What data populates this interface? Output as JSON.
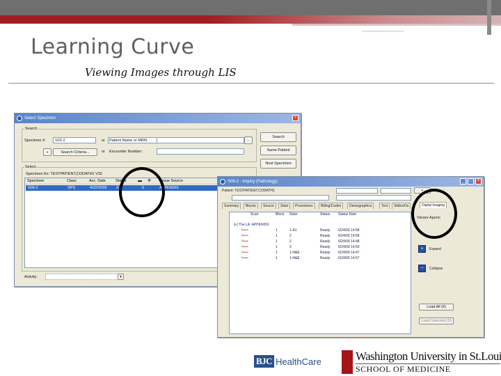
{
  "slide": {
    "title": "Learning Curve",
    "subtitle": "Viewing Images through LIS"
  },
  "select_window": {
    "title": "Select Specimen",
    "search_group_label": "Search",
    "specimen_label": "Specimen #:",
    "specimen_value": "S09-2",
    "or_label_1": "or",
    "patient_label": "Patient Name or MRN:",
    "or_label_2": "or",
    "search_criteria_button": "Search Criteria...",
    "encounter_label": "Encounter Number:",
    "search_button": "Search",
    "same_patient_button": "Same Patient",
    "next_specimen_button": "Next Specimen",
    "select_group_label": "Select",
    "specimen_for_label": "Specimen for: TESTPATIENT,CODATH1 V32",
    "columns": [
      "Specimen",
      "Class",
      "Acc. Date",
      "Status",
      "",
      "",
      "Tissue Source"
    ],
    "row": {
      "specimen": "S09-2",
      "class": "SPS",
      "date": "4/22/2009",
      "status": "S",
      "count": "6",
      "source": "APPENDIX"
    },
    "activity_label": "Activity:"
  },
  "inquiry_window": {
    "title": "S09-2 - Inquiry (Pathology)",
    "patient_label": "Patient: TESTPATIENT,CODATH1",
    "tabs": [
      "Summary",
      "Blocks",
      "Source",
      "Stain",
      "Procedures",
      "Billing/Codes",
      "Demographics",
      "Text",
      "Slides/Os",
      "Digital Imaging"
    ],
    "right_tab": "Digital Imaging",
    "viewer_label": "Viewer Aperio",
    "tree_headers": [
      "Scan",
      "Block",
      "Stain",
      "Status",
      "Status Date"
    ],
    "root_item": "[+] The LA: APPENDIX",
    "rows": [
      {
        "block": "1",
        "stain": "1-A1",
        "status": "Ready",
        "date": "6/24/09 14:58"
      },
      {
        "block": "1",
        "stain": "2",
        "status": "Ready",
        "date": "6/24/09 14:58"
      },
      {
        "block": "1",
        "stain": "2",
        "status": "Ready",
        "date": "6/24/09 14:48"
      },
      {
        "block": "1",
        "stain": "3",
        "status": "Ready",
        "date": "6/24/09 14:50"
      },
      {
        "block": "1",
        "stain": "1-H&E",
        "status": "Ready",
        "date": "6/24/09 14:47"
      },
      {
        "block": "1",
        "stain": "1-H&E",
        "status": "Ready",
        "date": "6/24/09 14:57"
      }
    ],
    "expand_button": "Expand",
    "collapse_button": "Collapse",
    "load_all_button": "Load All (6)",
    "load_selected_button": "Load Selected (0)"
  },
  "logos": {
    "bjc_mark": "BJC",
    "bjc_text": "HealthCare",
    "wu_name": "Washington University in St.Louis",
    "wu_sub": "SCHOOL OF MEDICINE"
  },
  "colors": {
    "header_gray": "#6f6f6f",
    "header_red": "#a11d21",
    "selection_blue": "#316ac5",
    "wu_red": "#a51417",
    "bjc_blue": "#2b4f8a"
  }
}
